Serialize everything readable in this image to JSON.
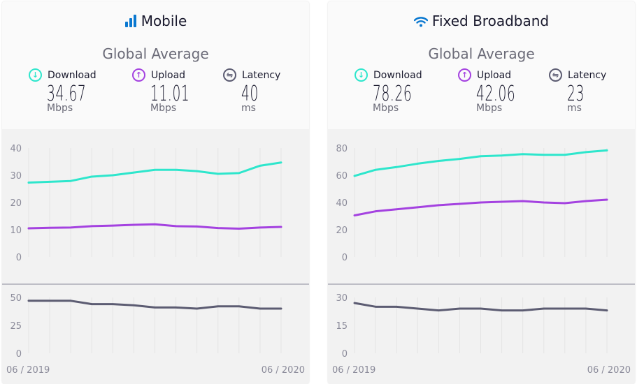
{
  "colors": {
    "download": "#2ee6cc",
    "upload": "#a442e0",
    "latency": "#5c5c72",
    "accent": "#0a78d0"
  },
  "panels": [
    {
      "title": "Mobile",
      "icon": "signal-bars-icon",
      "subtitle": "Global Average",
      "metrics": [
        {
          "label": "Download",
          "icon": "download-icon",
          "value": "34.67",
          "unit": "Mbps"
        },
        {
          "label": "Upload",
          "icon": "upload-icon",
          "value": "11.01",
          "unit": "Mbps"
        },
        {
          "label": "Latency",
          "icon": "latency-icon",
          "value": "40",
          "unit": "ms"
        }
      ],
      "x_start_label": "06 / 2019",
      "x_end_label": "06 / 2020"
    },
    {
      "title": "Fixed Broadband",
      "icon": "wifi-icon",
      "subtitle": "Global Average",
      "metrics": [
        {
          "label": "Download",
          "icon": "download-icon",
          "value": "78.26",
          "unit": "Mbps"
        },
        {
          "label": "Upload",
          "icon": "upload-icon",
          "value": "42.06",
          "unit": "Mbps"
        },
        {
          "label": "Latency",
          "icon": "latency-icon",
          "value": "23",
          "unit": "ms"
        }
      ],
      "x_start_label": "06 / 2019",
      "x_end_label": "06 / 2020"
    }
  ],
  "chart_data": [
    {
      "type": "line",
      "panel": "Mobile",
      "x": [
        "06/2019",
        "07/2019",
        "08/2019",
        "09/2019",
        "10/2019",
        "11/2019",
        "12/2019",
        "01/2020",
        "02/2020",
        "03/2020",
        "04/2020",
        "05/2020",
        "06/2020"
      ],
      "speed": {
        "ylim": [
          0,
          40
        ],
        "yticks": [
          "0",
          "10",
          "20",
          "30",
          "40"
        ],
        "series": [
          {
            "name": "Download",
            "values": [
              27.3,
              27.6,
              27.9,
              29.5,
              30,
              31,
              32,
              32,
              31.5,
              30.5,
              30.8,
              33.5,
              34.67
            ]
          },
          {
            "name": "Upload",
            "values": [
              10.5,
              10.7,
              10.8,
              11.3,
              11.5,
              11.8,
              12,
              11.3,
              11.2,
              10.6,
              10.4,
              10.8,
              11.01
            ]
          }
        ]
      },
      "latency": {
        "ylim": [
          0,
          50
        ],
        "yticks": [
          "0",
          "25",
          "50"
        ],
        "series": [
          {
            "name": "Latency",
            "values": [
              47,
              47,
              47,
              44,
              44,
              43,
              41,
              41,
              40,
              42,
              42,
              40,
              40
            ]
          }
        ]
      },
      "grid": true
    },
    {
      "type": "line",
      "panel": "Fixed Broadband",
      "x": [
        "06/2019",
        "07/2019",
        "08/2019",
        "09/2019",
        "10/2019",
        "11/2019",
        "12/2019",
        "01/2020",
        "02/2020",
        "03/2020",
        "04/2020",
        "05/2020",
        "06/2020"
      ],
      "speed": {
        "ylim": [
          0,
          80
        ],
        "yticks": [
          "0",
          "20",
          "40",
          "60",
          "80"
        ],
        "series": [
          {
            "name": "Download",
            "values": [
              59.5,
              64,
              66,
              68.5,
              70.5,
              72,
              74,
              74.5,
              75.5,
              75,
              75,
              77,
              78.26
            ]
          },
          {
            "name": "Upload",
            "values": [
              30.5,
              33.5,
              35,
              36.5,
              38,
              39,
              40,
              40.5,
              41,
              40,
              39.5,
              41,
              42.06
            ]
          }
        ]
      },
      "latency": {
        "ylim": [
          0,
          30
        ],
        "yticks": [
          "0",
          "15",
          "30"
        ],
        "series": [
          {
            "name": "Latency",
            "values": [
              27,
              25,
              25,
              24,
              23,
              24,
              24,
              23,
              23,
              24,
              24,
              24,
              23
            ]
          }
        ]
      },
      "grid": true
    }
  ]
}
